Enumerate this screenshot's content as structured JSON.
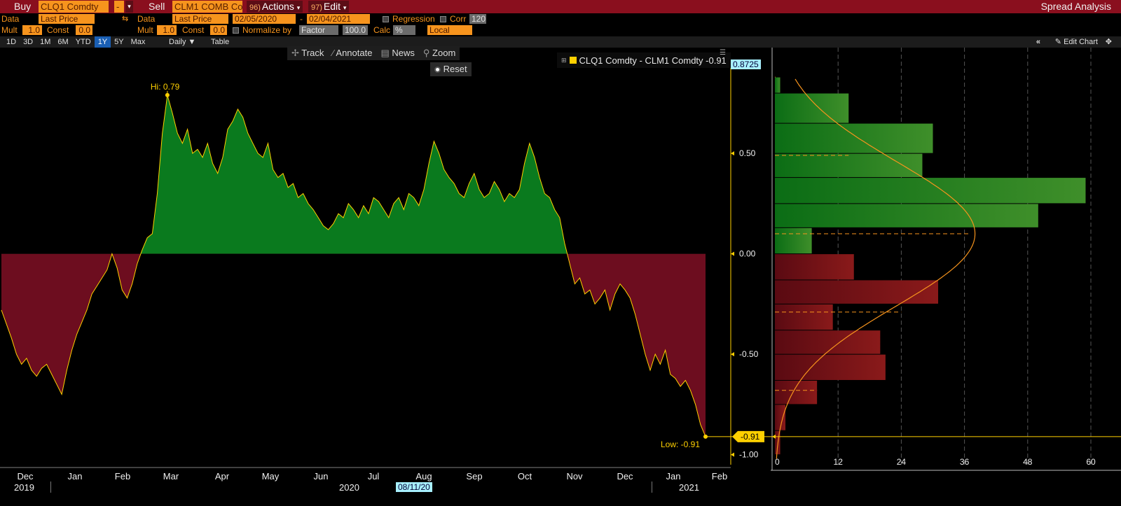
{
  "topbar": {
    "buy_label": "Buy",
    "buy_ticker": "CLQ1 Comdty",
    "buy_dash": "-",
    "sell_label": "Sell",
    "sell_ticker": "CLM1 COMB Co",
    "actions_num": "96)",
    "actions_label": "Actions",
    "edit_num": "97)",
    "edit_label": "Edit",
    "title": "Spread Analysis"
  },
  "row2": {
    "data_label1": "Data",
    "data_value1": "Last Price",
    "data_label2": "Data",
    "data_value2": "Last Price",
    "date_from": "02/05/2020",
    "date_sep": "-",
    "date_to": "02/04/2021",
    "regression_label": "Regression",
    "corr_label": "Corr",
    "corr_value": "120"
  },
  "row3": {
    "mult_label1": "Mult",
    "mult_value1": "1.0",
    "const_label1": "Const",
    "const_value1": "0.0",
    "mult_label2": "Mult",
    "mult_value2": "1.0",
    "const_label2": "Const",
    "const_value2": "0.0",
    "normalize_label": "Normalize by",
    "normalize_value": "Factor",
    "normalize_num": "100.0",
    "calc_label": "Calc",
    "calc_value": "%",
    "local_value": "Local"
  },
  "range_buttons": [
    "1D",
    "3D",
    "1M",
    "6M",
    "YTD",
    "1Y",
    "5Y",
    "Max"
  ],
  "range_selected": "1Y",
  "daily_label": "Daily ▼",
  "table_label": "Table",
  "edit_chart_label": "Edit Chart",
  "tools": {
    "track": "Track",
    "annotate": "Annotate",
    "news": "News",
    "zoom": "Zoom",
    "reset": "Reset"
  },
  "legend": {
    "text": "CLQ1 Comdty - CLM1 Comdty -0.91",
    "last_value_box": "0.8725"
  },
  "chart_data": {
    "type": "area",
    "series": [
      {
        "name": "CLQ1 Comdty - CLM1 Comdty",
        "values": [
          -0.28,
          -0.35,
          -0.42,
          -0.5,
          -0.55,
          -0.52,
          -0.58,
          -0.61,
          -0.57,
          -0.55,
          -0.6,
          -0.65,
          -0.7,
          -0.58,
          -0.48,
          -0.4,
          -0.34,
          -0.28,
          -0.2,
          -0.16,
          -0.12,
          -0.08,
          0.0,
          -0.07,
          -0.18,
          -0.22,
          -0.15,
          -0.05,
          0.02,
          0.08,
          0.1,
          0.3,
          0.6,
          0.79,
          0.7,
          0.6,
          0.55,
          0.62,
          0.5,
          0.52,
          0.48,
          0.55,
          0.45,
          0.4,
          0.48,
          0.62,
          0.66,
          0.72,
          0.68,
          0.6,
          0.55,
          0.5,
          0.48,
          0.55,
          0.42,
          0.38,
          0.4,
          0.33,
          0.35,
          0.28,
          0.3,
          0.25,
          0.22,
          0.18,
          0.14,
          0.12,
          0.15,
          0.2,
          0.18,
          0.25,
          0.22,
          0.18,
          0.24,
          0.2,
          0.28,
          0.26,
          0.22,
          0.18,
          0.25,
          0.28,
          0.22,
          0.3,
          0.28,
          0.24,
          0.32,
          0.45,
          0.56,
          0.5,
          0.42,
          0.38,
          0.35,
          0.3,
          0.28,
          0.35,
          0.4,
          0.32,
          0.28,
          0.3,
          0.36,
          0.32,
          0.26,
          0.3,
          0.28,
          0.32,
          0.45,
          0.55,
          0.48,
          0.38,
          0.3,
          0.28,
          0.22,
          0.18,
          0.05,
          -0.05,
          -0.15,
          -0.12,
          -0.2,
          -0.18,
          -0.25,
          -0.22,
          -0.18,
          -0.28,
          -0.2,
          -0.15,
          -0.18,
          -0.22,
          -0.3,
          -0.4,
          -0.5,
          -0.58,
          -0.5,
          -0.55,
          -0.48,
          -0.6,
          -0.62,
          -0.66,
          -0.63,
          -0.68,
          -0.75,
          -0.85,
          -0.91
        ]
      }
    ],
    "y_ticks": [
      "0.50",
      "0.00",
      "-0.50",
      "-1.00"
    ],
    "ylim": [
      -1.05,
      0.95
    ],
    "x_month_labels": [
      "Dec",
      "Jan",
      "Feb",
      "Mar",
      "Apr",
      "May",
      "Jun",
      "Jul",
      "Aug",
      "Sep",
      "Oct",
      "Nov",
      "Dec",
      "Jan",
      "Feb"
    ],
    "x_year_labels": [
      "2019",
      "2020",
      "2021"
    ],
    "cursor_date": "08/11/20",
    "hi_label": "Hi: 0.79",
    "low_label": "Low: -0.91",
    "last_value_label": "-0.91",
    "positive_color": "#0a7a1e",
    "negative_color": "#6d0d1f",
    "line_color": "#ffd000"
  },
  "histogram": {
    "type": "bar",
    "orientation": "horizontal",
    "bins": [
      {
        "from": 0.8,
        "to": 0.88,
        "count": 1
      },
      {
        "from": 0.65,
        "to": 0.8,
        "count": 14
      },
      {
        "from": 0.5,
        "to": 0.65,
        "count": 30
      },
      {
        "from": 0.38,
        "to": 0.5,
        "count": 28
      },
      {
        "from": 0.25,
        "to": 0.38,
        "count": 59
      },
      {
        "from": 0.13,
        "to": 0.25,
        "count": 50
      },
      {
        "from": 0.0,
        "to": 0.13,
        "count": 7
      },
      {
        "from": -0.13,
        "to": 0.0,
        "count": 15
      },
      {
        "from": -0.25,
        "to": -0.13,
        "count": 31
      },
      {
        "from": -0.38,
        "to": -0.25,
        "count": 11
      },
      {
        "from": -0.5,
        "to": -0.38,
        "count": 20
      },
      {
        "from": -0.63,
        "to": -0.5,
        "count": 21
      },
      {
        "from": -0.75,
        "to": -0.63,
        "count": 8
      },
      {
        "from": -0.88,
        "to": -0.75,
        "count": 2
      },
      {
        "from": -1.0,
        "to": -0.88,
        "count": 1
      }
    ],
    "x_ticks": [
      "0",
      "12",
      "24",
      "36",
      "48",
      "60"
    ],
    "xlim": [
      0,
      60
    ]
  }
}
